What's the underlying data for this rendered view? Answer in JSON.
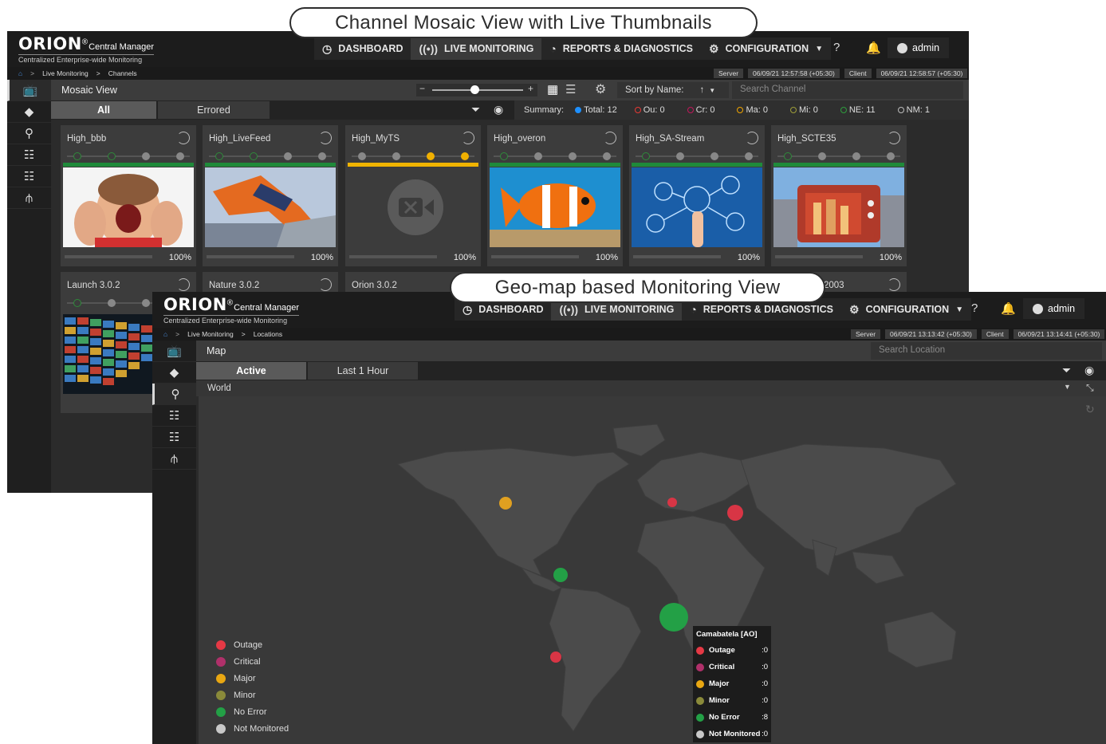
{
  "callouts": {
    "mosaic": "Channel Mosaic View with Live Thumbnails",
    "geo": "Geo-map based Monitoring View"
  },
  "app": {
    "brand": "ORION",
    "reg": "®",
    "product": "Central Manager",
    "tagline": "Centralized Enterprise-wide Monitoring",
    "nav": [
      "DASHBOARD",
      "LIVE MONITORING",
      "REPORTS & DIAGNOSTICS",
      "CONFIGURATION"
    ],
    "user": "admin",
    "server_label": "Server",
    "client_label": "Client"
  },
  "win1": {
    "breadcrumb": [
      "Live Monitoring",
      ">",
      "Channels"
    ],
    "server_time": "06/09/21 12:57:58 (+05:30)",
    "client_time": "06/09/21 12:58:57 (+05:30)",
    "title": "Mosaic View",
    "sort_label": "Sort by Name:",
    "sort_dir": "↑",
    "search_placeholder": "Search Channel",
    "tabs": [
      "All",
      "Errored"
    ],
    "summary": {
      "label": "Summary:",
      "items": [
        {
          "text": "Total: 12",
          "color": "#1e90ff"
        },
        {
          "text": "Ou: 0",
          "color": "#e53935"
        },
        {
          "text": "Cr: 0",
          "color": "#c2185b"
        },
        {
          "text": "Ma: 0",
          "color": "#f0a500"
        },
        {
          "text": "Mi: 0",
          "color": "#9e9e3a"
        },
        {
          "text": "NE: 11",
          "color": "#2e9d3e"
        },
        {
          "text": "NM: 1",
          "color": "#bdbdbd"
        }
      ]
    },
    "tiles": [
      {
        "name": "High_bbb",
        "pct": "100%"
      },
      {
        "name": "High_LiveFeed",
        "pct": "100%"
      },
      {
        "name": "High_MyTS",
        "pct": "100%"
      },
      {
        "name": "High_overon",
        "pct": "100%"
      },
      {
        "name": "High_SA-Stream",
        "pct": "100%"
      },
      {
        "name": "High_SCTE35",
        "pct": "100%"
      }
    ],
    "row2": [
      "Launch 3.0.2",
      "Nature 3.0.2",
      "Orion 3.0.2",
      "2003"
    ]
  },
  "win2": {
    "breadcrumb": [
      "Live Monitoring",
      ">",
      "Locations"
    ],
    "server_time": "06/09/21 13:13:42 (+05:30)",
    "client_time": "06/09/21 13:14:41 (+05:30)",
    "title": "Map",
    "search_placeholder": "Search Location",
    "tabs": [
      "Active",
      "Last 1 Hour"
    ],
    "region": "World",
    "legend": [
      {
        "label": "Outage",
        "color": "#e53945"
      },
      {
        "label": "Critical",
        "color": "#b0306a"
      },
      {
        "label": "Major",
        "color": "#e9a712"
      },
      {
        "label": "Minor",
        "color": "#8a8a3a"
      },
      {
        "label": "No Error",
        "color": "#23a046"
      },
      {
        "label": "Not Monitored",
        "color": "#c8c8c8"
      }
    ],
    "tooltip": {
      "title": "Camabatela [AO]",
      "rows": [
        {
          "label": "Outage",
          "value": ":0",
          "color": "#e53945"
        },
        {
          "label": "Critical",
          "value": ":0",
          "color": "#b0306a"
        },
        {
          "label": "Major",
          "value": ":0",
          "color": "#e9a712"
        },
        {
          "label": "Minor",
          "value": ":0",
          "color": "#8a8a3a"
        },
        {
          "label": "No Error",
          "value": ":8",
          "color": "#23a046"
        },
        {
          "label": "Not Monitored",
          "value": ":0",
          "color": "#c8c8c8"
        }
      ]
    },
    "markers": [
      {
        "status": "Major",
        "color": "#e0a020"
      },
      {
        "status": "Outage",
        "color": "#d83545"
      },
      {
        "status": "Outage",
        "color": "#d83545"
      },
      {
        "status": "No Error",
        "color": "#23a046"
      },
      {
        "status": "No Error",
        "color": "#23a046"
      },
      {
        "status": "Outage",
        "color": "#d83545"
      }
    ]
  }
}
